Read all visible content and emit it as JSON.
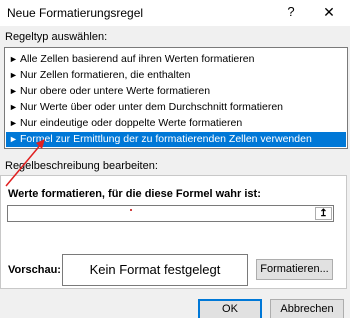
{
  "dialog": {
    "title": "Neue Formatierungsregel",
    "help": "?",
    "close": "✕"
  },
  "rule_type": {
    "label": "Regeltyp auswählen:",
    "items": [
      {
        "label": "Alle Zellen basierend auf ihren Werten formatieren",
        "selected": false
      },
      {
        "label": "Nur Zellen formatieren, die enthalten",
        "selected": false
      },
      {
        "label": "Nur obere oder untere Werte formatieren",
        "selected": false
      },
      {
        "label": "Nur Werte über oder unter dem Durchschnitt formatieren",
        "selected": false
      },
      {
        "label": "Nur eindeutige oder doppelte Werte formatieren",
        "selected": false
      },
      {
        "label": "Formel zur Ermittlung der zu formatierenden Zellen verwenden",
        "selected": true
      }
    ]
  },
  "description": {
    "label": "Regelbeschreibung bearbeiten:",
    "formula_label": "Werte formatieren, für die diese Formel wahr ist:",
    "formula_value": "",
    "collapse_icon": "↥",
    "preview_label": "Vorschau:",
    "preview_text": "Kein Format festgelegt",
    "format_button": "Formatieren..."
  },
  "buttons": {
    "ok": "OK",
    "cancel": "Abbrechen"
  },
  "colors": {
    "selection": "#0078d7",
    "annotation_arrow": "#e02020"
  }
}
